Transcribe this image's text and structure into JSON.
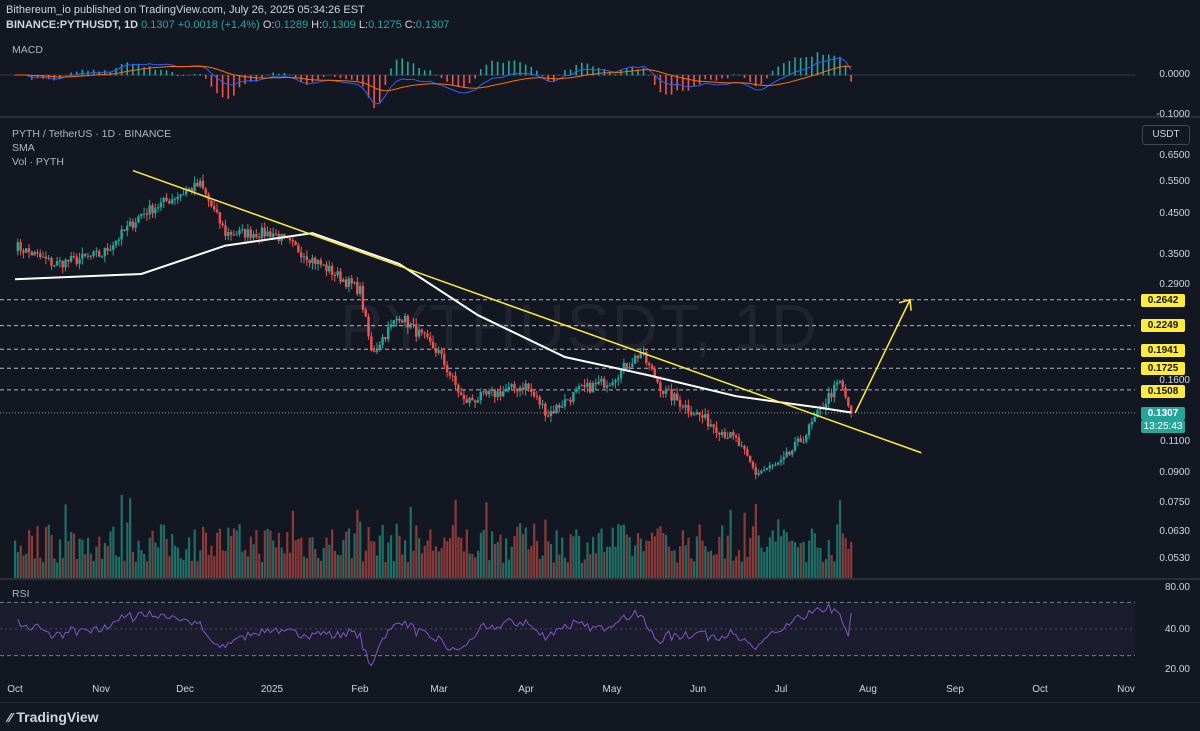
{
  "header": {
    "publisher_line": "Bithereum_io published on TradingView.com, July 26, 2025 05:34:26 EST",
    "symbol": "BINANCE:PYTHUSDT, 1D",
    "last": "0.1307",
    "change": "+0.0018 (+1.4%)",
    "o_label": "O:",
    "o": "0.1289",
    "h_label": "H:",
    "h": "0.1309",
    "l_label": "L:",
    "l": "0.1275",
    "c_label": "C:",
    "c": "0.1307"
  },
  "panes": {
    "macd_label": "MACD",
    "macd_ticks": [
      "0.0000",
      "-0.1000"
    ],
    "main_title": "PYTH / TetherUS · 1D · BINANCE",
    "sma_label": "SMA",
    "vol_label": "Vol · PYTH",
    "currency": "USDT",
    "price_ticks": [
      "0.6500",
      "0.5500",
      "0.4500",
      "0.3500",
      "0.2900",
      "0.1600",
      "0.1100",
      "0.0900",
      "0.0750",
      "0.0630",
      "0.0530"
    ],
    "rsi_label": "RSI",
    "rsi_ticks": [
      "80.00",
      "40.00",
      "20.00"
    ],
    "watermark": "PYTHUSDT, 1D"
  },
  "levels": [
    "0.2642",
    "0.2249",
    "0.1941",
    "0.1725",
    "0.1508"
  ],
  "last_price_badge": "0.1307",
  "countdown": "13:25:43",
  "xaxis": [
    "Oct",
    "Nov",
    "Dec",
    "2025",
    "Feb",
    "Mar",
    "Apr",
    "May",
    "Jun",
    "Jul",
    "Aug",
    "Sep",
    "Oct",
    "Nov"
  ],
  "footer": {
    "brand": "TradingView"
  },
  "colors": {
    "bg": "#131722",
    "up": "#26a69a",
    "down": "#ef5350",
    "sma": "#ffffff",
    "trend": "#ffeb3b",
    "rsi": "#7e57c2",
    "macd": "#2962ff",
    "signal": "#ff6d00"
  },
  "chart_data": {
    "type": "candlestick",
    "title": "PYTH / TetherUS · 1D · BINANCE",
    "y_scale": "log",
    "ylim": [
      0.05,
      0.7
    ],
    "key_closes": {
      "x": [
        "2024-10-01",
        "2024-10-15",
        "2024-11-01",
        "2024-11-15",
        "2024-12-01",
        "2024-12-06",
        "2024-12-15",
        "2025-01-01",
        "2025-01-15",
        "2025-02-01",
        "2025-02-05",
        "2025-02-15",
        "2025-03-01",
        "2025-03-10",
        "2025-04-01",
        "2025-04-09",
        "2025-04-20",
        "2025-05-01",
        "2025-05-12",
        "2025-05-20",
        "2025-06-01",
        "2025-06-15",
        "2025-06-22",
        "2025-07-01",
        "2025-07-10",
        "2025-07-18",
        "2025-07-22",
        "2025-07-26"
      ],
      "close": [
        0.37,
        0.33,
        0.35,
        0.45,
        0.52,
        0.54,
        0.4,
        0.4,
        0.34,
        0.28,
        0.19,
        0.24,
        0.19,
        0.14,
        0.155,
        0.13,
        0.15,
        0.16,
        0.19,
        0.15,
        0.13,
        0.11,
        0.09,
        0.095,
        0.115,
        0.145,
        0.158,
        0.1307
      ]
    },
    "sma_line": {
      "x": [
        "2024-10-01",
        "2024-11-15",
        "2024-12-15",
        "2025-01-15",
        "2025-02-15",
        "2025-03-15",
        "2025-04-15",
        "2025-05-15",
        "2025-06-15",
        "2025-07-15",
        "2025-07-26"
      ],
      "y": [
        0.3,
        0.31,
        0.37,
        0.4,
        0.33,
        0.24,
        0.185,
        0.165,
        0.145,
        0.135,
        0.131
      ]
    },
    "trendline": {
      "x": [
        "2024-11-12",
        "2025-08-20"
      ],
      "y": [
        0.59,
        0.102
      ]
    },
    "horizontal_levels": [
      0.2642,
      0.2249,
      0.1941,
      0.1725,
      0.1508
    ],
    "rsi": {
      "levels": [
        70,
        30
      ],
      "last": 62
    },
    "macd": {
      "zero_line": 0.0
    }
  }
}
